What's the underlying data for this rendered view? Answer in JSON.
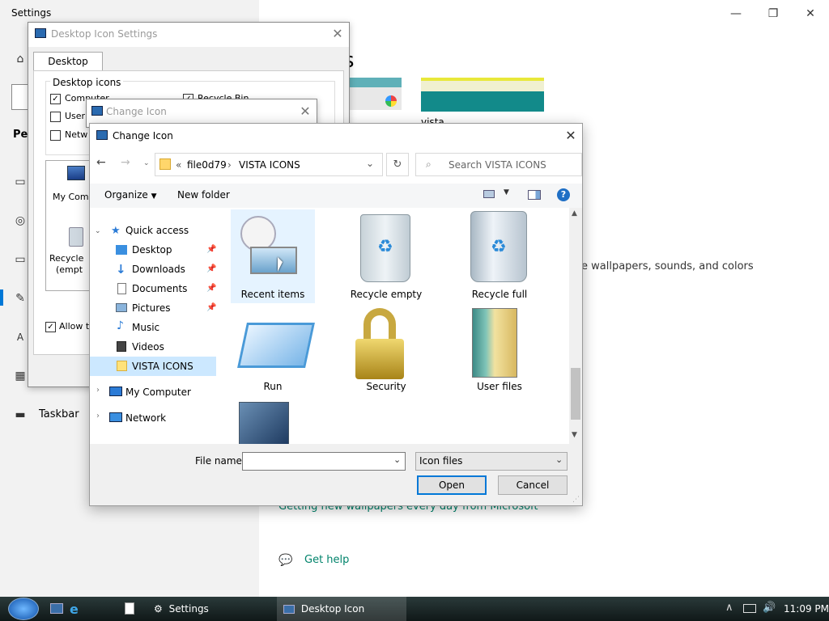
{
  "settings": {
    "title": "Settings",
    "nav_perso_fragment": "Per",
    "taskbar_nav_label": "Taskbar",
    "heading_fragment": "s",
    "theme_name": "vista",
    "description_fragment": "e wallpapers, sounds, and colors",
    "link_wallpapers": "Getting new wallpapers every day from Microsoft",
    "get_help": "Get help"
  },
  "desktop_icon_settings": {
    "title": "Desktop Icon Settings",
    "tab": "Desktop Icons",
    "group_label": "Desktop icons",
    "checkboxes": [
      {
        "label": "Computer",
        "checked": true
      },
      {
        "label": "User",
        "checked": false
      },
      {
        "label": "Netw",
        "checked": false
      },
      {
        "label": "Recycle Bin",
        "checked": true
      }
    ],
    "icons": [
      "My Comp",
      "Recycle",
      "(empt"
    ],
    "allow_label": "Allow t"
  },
  "change_icon_back": {
    "title": "Change Icon"
  },
  "change_icon": {
    "title": "Change Icon",
    "breadcrumb_prefix": "«",
    "breadcrumb": [
      "file0d79",
      "VISTA ICONS"
    ],
    "search_placeholder": "Search VISTA ICONS",
    "organize": "Organize",
    "new_folder": "New folder",
    "nav": [
      {
        "label": "Quick access",
        "pinned": false
      },
      {
        "label": "Desktop",
        "pinned": true
      },
      {
        "label": "Downloads",
        "pinned": true
      },
      {
        "label": "Documents",
        "pinned": true
      },
      {
        "label": "Pictures",
        "pinned": true
      },
      {
        "label": "Music",
        "pinned": false
      },
      {
        "label": "Videos",
        "pinned": false
      },
      {
        "label": "VISTA ICONS",
        "pinned": false,
        "selected": true
      },
      {
        "label": "My Computer",
        "pinned": false
      },
      {
        "label": "Network",
        "pinned": false
      }
    ],
    "files": [
      "Recent items",
      "Recycle empty",
      "Recycle full",
      "Run",
      "Security",
      "User files"
    ],
    "file_name_label": "File name:",
    "file_name_value": "",
    "filter": "Icon files",
    "open": "Open",
    "cancel": "Cancel"
  },
  "taskbar": {
    "items": [
      "Settings",
      "Desktop Icon Settings"
    ],
    "time": "11:09 PM"
  },
  "colors": {
    "accent": "#0078d7",
    "link": "#00836b",
    "selection": "#cce8ff"
  }
}
